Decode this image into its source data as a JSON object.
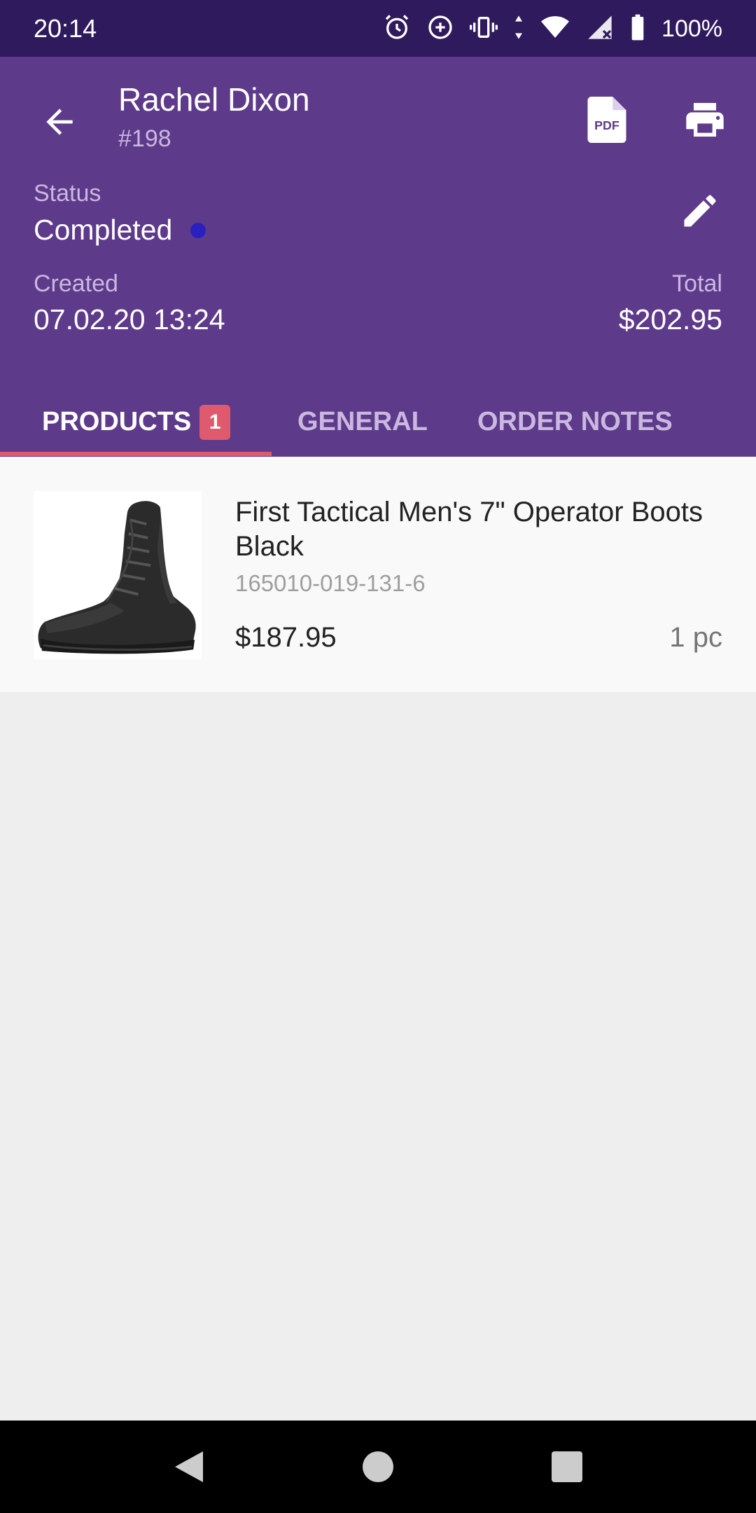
{
  "status_bar": {
    "time": "20:14",
    "battery": "100%",
    "icons": [
      "alarm-icon",
      "data-saver-icon",
      "vibrate-icon",
      "data-arrows-icon",
      "wifi-icon",
      "signal-icon",
      "battery-icon"
    ]
  },
  "header": {
    "customer_name": "Rachel Dixon",
    "order_number": "#198",
    "status_label": "Status",
    "status_value": "Completed",
    "status_dot_color": "#2a1fbf",
    "created_label": "Created",
    "created_value": "07.02.20 13:24",
    "total_label": "Total",
    "total_value": "$202.95",
    "actions": [
      "back-arrow-icon",
      "pdf-icon",
      "print-icon",
      "edit-pencil-icon"
    ]
  },
  "tabs": [
    {
      "label": "PRODUCTS",
      "badge": "1",
      "selected": true
    },
    {
      "label": "GENERAL",
      "selected": false
    },
    {
      "label": "ORDER NOTES",
      "selected": false
    }
  ],
  "products": [
    {
      "name": "First Tactical Men's 7\" Operator Boots Black",
      "sku": "165010-019-131-6",
      "price": "$187.95",
      "quantity": "1 pc",
      "image": "black-tactical-boot"
    }
  ],
  "colors": {
    "status_bar": "#2e1a5c",
    "header": "#5e3a8a",
    "accent": "#e05a6e",
    "background": "#eeeeee"
  }
}
